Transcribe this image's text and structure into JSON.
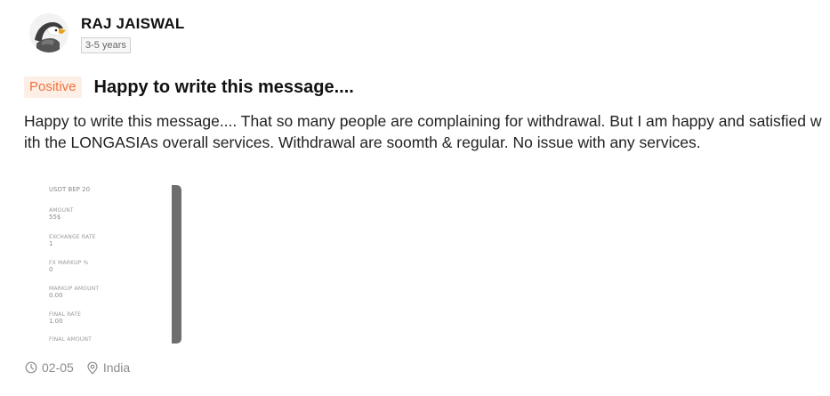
{
  "reviewer": {
    "name": "RAJ JAISWAL",
    "experience": "3-5 years",
    "avatar_icon": "eagle-icon"
  },
  "review": {
    "sentiment": "Positive",
    "title": "Happy to write this message....",
    "body": "Happy to write this message.... That so many people are complaining for withdrawal. But I am happy and satisfied with the LONGASIAs overall services. Withdrawal are soomth & regular. No issue with any services."
  },
  "attachment": {
    "top_value": "USDT BEP 20",
    "fields": [
      {
        "label": "AMOUNT",
        "value": "55$"
      },
      {
        "label": "EXCHANGE RATE",
        "value": "1"
      },
      {
        "label": "FX MARKUP %",
        "value": "0"
      },
      {
        "label": "MARKUP AMOUNT",
        "value": "0.00"
      },
      {
        "label": "FINAL RATE",
        "value": "1.00"
      }
    ],
    "last_label": "FINAL AMOUNT"
  },
  "meta": {
    "date": "02-05",
    "date_icon": "clock-icon",
    "location": "India",
    "location_icon": "location-pin-icon"
  },
  "colors": {
    "sentiment_text": "#f0733d",
    "sentiment_bg": "#fdeee6",
    "meta_text": "#8c8c8c"
  }
}
